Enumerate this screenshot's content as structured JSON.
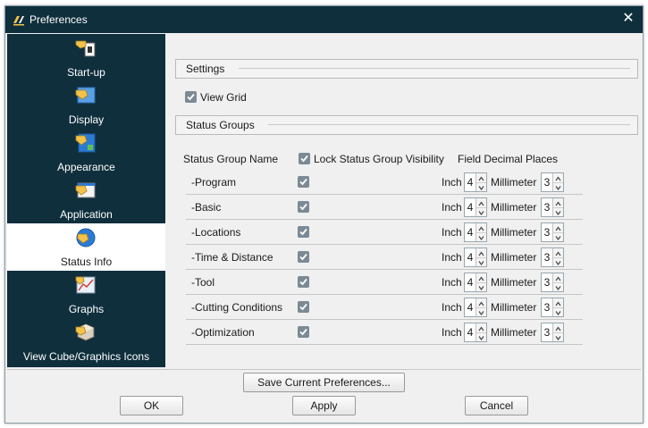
{
  "window": {
    "title": "Preferences",
    "logo_icon": "app-logo-icon",
    "close_icon": "close-icon",
    "titlebar_color": "#0f2f3d"
  },
  "sidebar": {
    "items": [
      {
        "label": "Start-up",
        "icon": "startup-icon",
        "active": false
      },
      {
        "label": "Display",
        "icon": "display-icon",
        "active": false
      },
      {
        "label": "Appearance",
        "icon": "appearance-icon",
        "active": false
      },
      {
        "label": "Application",
        "icon": "application-icon",
        "active": false
      },
      {
        "label": "Status Info",
        "icon": "status-info-icon",
        "active": true
      },
      {
        "label": "Graphs",
        "icon": "graphs-icon",
        "active": false
      },
      {
        "label": "View Cube/Graphics Icons",
        "icon": "view-cube-icon",
        "active": false
      }
    ]
  },
  "settings": {
    "title": "Settings",
    "view_grid_label": "View Grid",
    "view_grid_checked": true
  },
  "status_groups": {
    "title": "Status Groups",
    "col_name": "Status Group Name",
    "lock_label": "Lock Status Group Visibility",
    "lock_checked": true,
    "col_decimal": "Field Decimal Places",
    "inch_label": "Inch",
    "mm_label": "Millimeter",
    "rows": [
      {
        "name": "-Program",
        "checked": true,
        "inch": "4",
        "mm": "3"
      },
      {
        "name": "-Basic",
        "checked": true,
        "inch": "4",
        "mm": "3"
      },
      {
        "name": "-Locations",
        "checked": true,
        "inch": "4",
        "mm": "3"
      },
      {
        "name": "-Time & Distance",
        "checked": true,
        "inch": "4",
        "mm": "3"
      },
      {
        "name": "-Tool",
        "checked": true,
        "inch": "4",
        "mm": "3"
      },
      {
        "name": "-Cutting Conditions",
        "checked": true,
        "inch": "4",
        "mm": "3"
      },
      {
        "name": "-Optimization",
        "checked": true,
        "inch": "4",
        "mm": "3"
      }
    ]
  },
  "buttons": {
    "save": "Save Current Preferences...",
    "ok": "OK",
    "apply": "Apply",
    "cancel": "Cancel"
  },
  "colors": {
    "sidebar_bg": "#0f2f3d",
    "checkbox": "#7b8a94",
    "accent_yellow": "#f2c24a",
    "accent_blue": "#2b7bd6"
  }
}
